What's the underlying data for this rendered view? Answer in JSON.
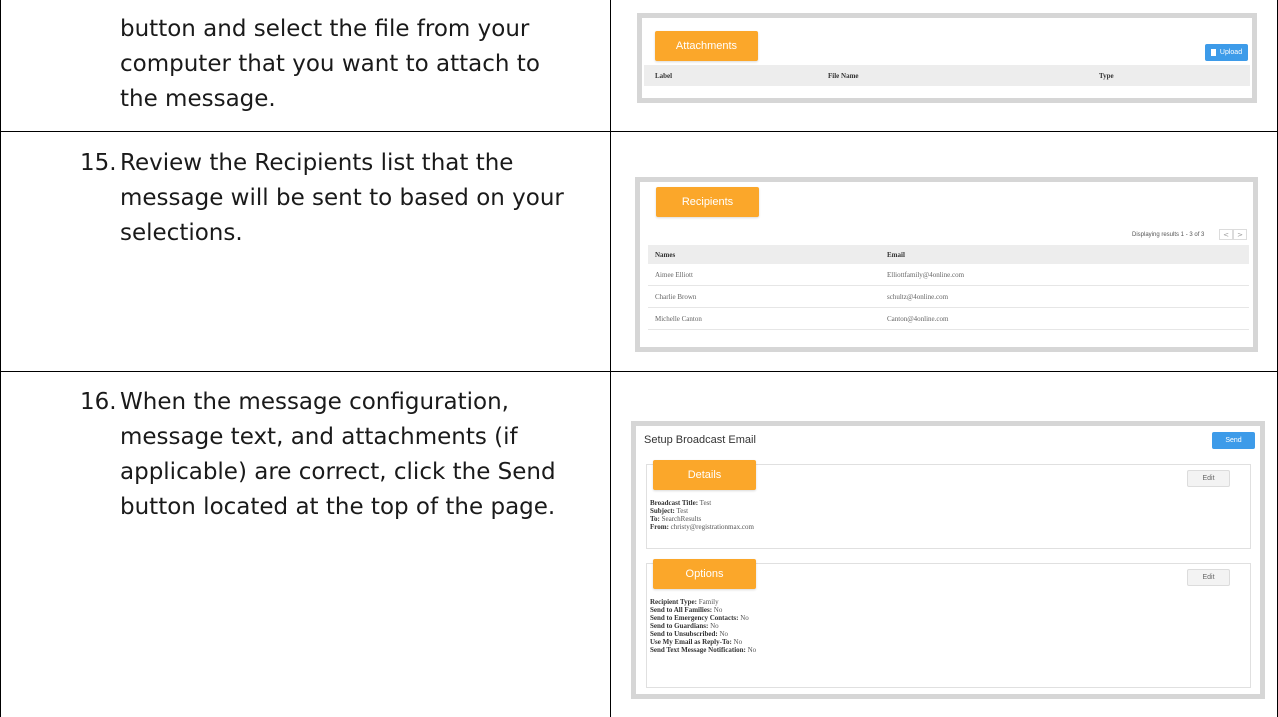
{
  "steps": {
    "step14": {
      "lines": [
        "button and select the file from your",
        "computer that you want to attach to",
        "the message."
      ]
    },
    "step15": {
      "number": "15.",
      "lines": [
        "Review the Recipients list that the",
        "message will be sent to based on your",
        "selections."
      ]
    },
    "step16": {
      "number": "16.",
      "lines": [
        "When the message configuration,",
        "message text, and attachments (if",
        "applicable) are correct, click the Send",
        "button located at the top of the page."
      ]
    }
  },
  "attachments_panel": {
    "tab": "Attachments",
    "upload_label": "Upload",
    "columns": [
      "Label",
      "File Name",
      "Type"
    ]
  },
  "recipients_panel": {
    "tab": "Recipients",
    "pager_text": "Displaying results 1 - 3 of 3",
    "prev": "<",
    "next": ">",
    "columns": [
      "Names",
      "Email"
    ],
    "rows": [
      [
        "Aimee Elliott",
        "Elliottfamily@4online.com"
      ],
      [
        "Charlie Brown",
        "schultz@4online.com"
      ],
      [
        "Michelle Canton",
        "Canton@4online.com"
      ]
    ]
  },
  "broadcast_panel": {
    "title": "Setup Broadcast Email",
    "send_label": "Send",
    "details": {
      "tab": "Details",
      "edit_label": "Edit",
      "fields": [
        {
          "label": "Broadcast Title:",
          "value": "Test"
        },
        {
          "label": "Subject:",
          "value": "Test"
        },
        {
          "label": "To:",
          "value": "SearchResults"
        },
        {
          "label": "From:",
          "value": "christy@registrationmax.com"
        }
      ]
    },
    "options": {
      "tab": "Options",
      "edit_label": "Edit",
      "fields": [
        {
          "label": "Recipient Type:",
          "value": "Family"
        },
        {
          "label": "Send to All Families:",
          "value": "No"
        },
        {
          "label": "Send to Emergency Contacts:",
          "value": "No"
        },
        {
          "label": "Send to Guardians:",
          "value": "No"
        },
        {
          "label": "Send to Unsubscribed:",
          "value": "No"
        },
        {
          "label": "Use My Email as Reply-To:",
          "value": "No"
        },
        {
          "label": "Send Text Message Notification:",
          "value": "No"
        }
      ]
    }
  },
  "colors": {
    "accent_orange": "#fba72a",
    "button_blue": "#3d9be9",
    "border": "#000000"
  }
}
